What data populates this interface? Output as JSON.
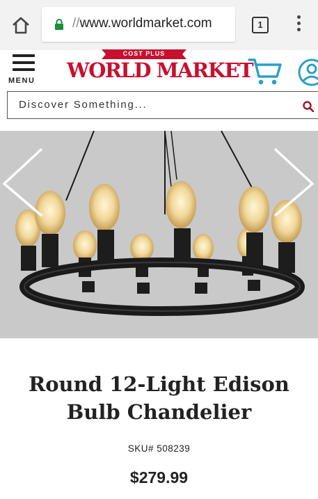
{
  "browser": {
    "url_scheme": "//",
    "url_host": "www.worldmarket.com",
    "tab_count": "1",
    "icons": {
      "home": "home-icon",
      "lock": "lock-icon",
      "tabs": "tab-switcher-icon",
      "menu": "more-vert-icon"
    }
  },
  "site": {
    "menu_label": "MENU",
    "logo_top": "COST PLUS",
    "logo_main": "WORLD MARKET",
    "search_placeholder": "Discover Something...",
    "colors": {
      "brand_red": "#c8102e",
      "accent_teal": "#2ba0c6"
    }
  },
  "product": {
    "title_line1": "Round 12-Light Edison",
    "title_line2": "Bulb Chandelier",
    "sku_label": "SKU#",
    "sku_value": "508239",
    "price": "$279.99"
  }
}
